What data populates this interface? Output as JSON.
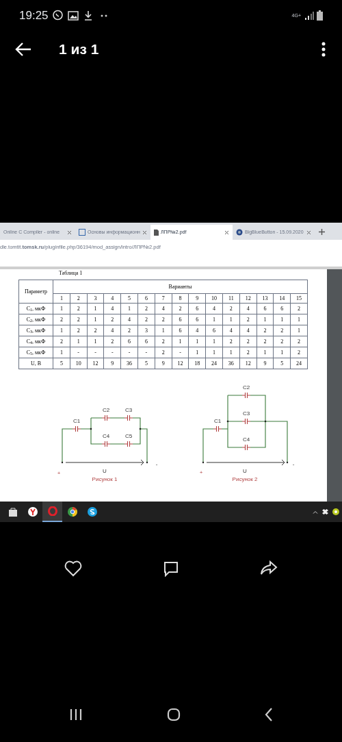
{
  "status_bar": {
    "time": "19:25",
    "network": "4G+"
  },
  "toolbar": {
    "title": "1 из 1"
  },
  "screenshot": {
    "browser": {
      "tabs": [
        {
          "title": "Online C Compiler - online",
          "selected": false
        },
        {
          "title": "Основы информационн",
          "selected": false
        },
        {
          "title": "ЛПР№2.pdf",
          "selected": true
        },
        {
          "title": "BigBlueButton - 15.09.2020",
          "selected": false
        }
      ],
      "address": "dle.tomtit.**tomsk.ru**/pluginfile.php/36194/mod_assign/intro/ЛПР№2.pdf"
    },
    "document": {
      "table_title": "Таблица 1",
      "table": {
        "row_header": "Параметр",
        "group_header": "Варианты",
        "variants": [
          "1",
          "2",
          "3",
          "4",
          "5",
          "6",
          "7",
          "8",
          "9",
          "10",
          "11",
          "12",
          "13",
          "14",
          "15"
        ],
        "rows": [
          {
            "label": "C$_{1}$, мкФ",
            "values": [
              "1",
              "2",
              "1",
              "4",
              "1",
              "2",
              "4",
              "2",
              "6",
              "4",
              "2",
              "4",
              "6",
              "6",
              "2"
            ]
          },
          {
            "label": "C$_{2}$, мкФ",
            "values": [
              "2",
              "2",
              "1",
              "2",
              "4",
              "2",
              "2",
              "6",
              "6",
              "1",
              "1",
              "2",
              "1",
              "1",
              "1"
            ]
          },
          {
            "label": "C$_{3}$, мкФ",
            "values": [
              "1",
              "2",
              "2",
              "4",
              "2",
              "3",
              "1",
              "6",
              "4",
              "6",
              "4",
              "4",
              "2",
              "2",
              "1"
            ]
          },
          {
            "label": "C$_{4}$, мкФ",
            "values": [
              "2",
              "1",
              "1",
              "2",
              "6",
              "6",
              "2",
              "1",
              "1",
              "1",
              "2",
              "2",
              "2",
              "2",
              "2"
            ]
          },
          {
            "label": "C$_{5}$, мкФ",
            "values": [
              "1",
              "-",
              "-",
              "-",
              "-",
              "-",
              "2",
              "-",
              "1",
              "1",
              "1",
              "2",
              "1",
              "1",
              "2"
            ]
          },
          {
            "label": "U, B",
            "values": [
              "5",
              "10",
              "12",
              "9",
              "36",
              "5",
              "9",
              "12",
              "18",
              "24",
              "36",
              "12",
              "9",
              "5",
              "24"
            ]
          }
        ]
      },
      "figures": [
        {
          "kind": "series-parallel",
          "labels": [
            "C1",
            "C2",
            "C3",
            "C4",
            "C5"
          ],
          "plus": "+",
          "minus": "-",
          "voltage": "U",
          "caption": "Рисунок 1"
        },
        {
          "kind": "parallel",
          "labels": [
            "C1",
            "C2",
            "C3",
            "C4"
          ],
          "plus": "+",
          "minus": "-",
          "voltage": "U",
          "caption": "Рисунок 2"
        }
      ]
    },
    "taskbar": {
      "apps": [
        {
          "kind": "store",
          "selected": false
        },
        {
          "kind": "yandex",
          "selected": false
        },
        {
          "kind": "opera",
          "selected": true
        },
        {
          "kind": "chrome",
          "selected": false
        },
        {
          "kind": "skype",
          "selected": false
        }
      ]
    }
  }
}
